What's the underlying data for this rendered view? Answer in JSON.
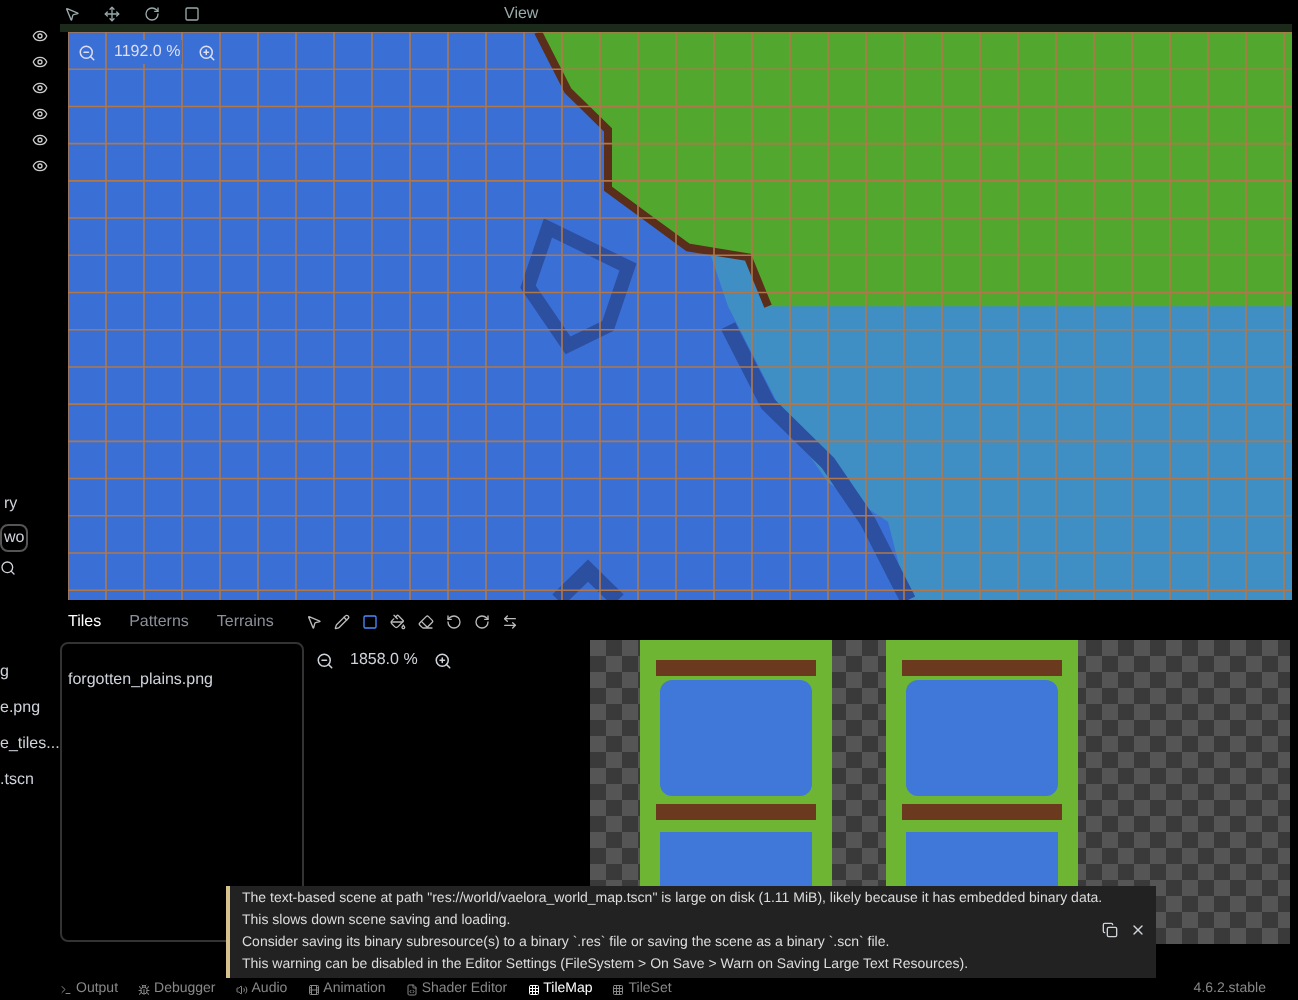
{
  "top_menu": {
    "label": "View"
  },
  "viewport": {
    "zoom": "1192.0 %"
  },
  "left_dock": {
    "label": "ry",
    "field_value": "wo",
    "files": [
      "g",
      "e.png",
      "e_tiles...",
      ".tscn"
    ]
  },
  "tilemap_panel": {
    "tabs": [
      {
        "label": "Tiles",
        "selected": true
      },
      {
        "label": "Patterns",
        "selected": false
      },
      {
        "label": "Terrains",
        "selected": false
      }
    ],
    "sources": [
      {
        "name": "forgotten_plains.png",
        "selected": false
      }
    ],
    "atlas_zoom": "1858.0 %"
  },
  "notification": {
    "lines": [
      "The text-based scene at path \"res://world/vaelora_world_map.tscn\" is large on disk (1.11 MiB), likely because it has embedded binary data.",
      "This slows down scene saving and loading.",
      "Consider saving its binary subresource(s) to a binary `.res` file or saving the scene as a binary `.scn` file.",
      "This warning can be disabled in the Editor Settings (FileSystem > On Save > Warn on Saving Large Text Resources)."
    ]
  },
  "bottom_bar": {
    "tabs": [
      {
        "label": "Output",
        "selected": false
      },
      {
        "label": "Debugger",
        "selected": false
      },
      {
        "label": "Audio",
        "selected": false
      },
      {
        "label": "Animation",
        "selected": false
      },
      {
        "label": "Shader Editor",
        "selected": false
      },
      {
        "label": "TileMap",
        "selected": true
      },
      {
        "label": "TileSet",
        "selected": false
      }
    ],
    "version": "4.6.2.stable"
  }
}
